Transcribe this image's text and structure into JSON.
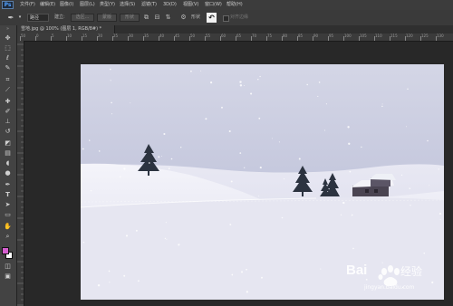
{
  "app": {
    "logo": "Ps"
  },
  "menu": [
    "文件(F)",
    "编辑(E)",
    "图像(I)",
    "图层(L)",
    "类型(Y)",
    "选择(S)",
    "滤镜(T)",
    "3D(D)",
    "视图(V)",
    "窗口(W)",
    "帮助(H)"
  ],
  "options": {
    "style_value": "路径",
    "fill_label": "建立:",
    "selection_btn": "选区...",
    "mask_btn": "蒙版",
    "shape_btn": "形状",
    "shape_label": "对齐边缘",
    "refine_label": "对齐边缘"
  },
  "document": {
    "tab_title": "雪地.jpg @ 100% (图层 1, RGB/8#) *"
  },
  "ruler_h": [
    "50",
    "0",
    "5",
    "10",
    "15",
    "20",
    "25",
    "30",
    "35",
    "40",
    "45",
    "50",
    "55",
    "60",
    "65",
    "70",
    "75",
    "80",
    "85",
    "90",
    "95",
    "100",
    "105",
    "110",
    "115",
    "120",
    "125",
    "130"
  ],
  "watermark": {
    "brand": "Bai",
    "brand2": "经验",
    "url": "jingyan.baidu.com"
  },
  "colors": {
    "foreground": "#d65fd0",
    "background": "#ffffff"
  },
  "icons": [
    "move-icon",
    "marquee-icon",
    "lasso-icon",
    "quick-select-icon",
    "crop-icon",
    "eyedropper-icon",
    "healing-icon",
    "brush-icon",
    "stamp-icon",
    "history-brush-icon",
    "eraser-icon",
    "gradient-icon",
    "blur-icon",
    "dodge-icon",
    "pen-icon",
    "type-icon",
    "path-select-icon",
    "shape-icon",
    "hand-icon",
    "zoom-icon"
  ]
}
